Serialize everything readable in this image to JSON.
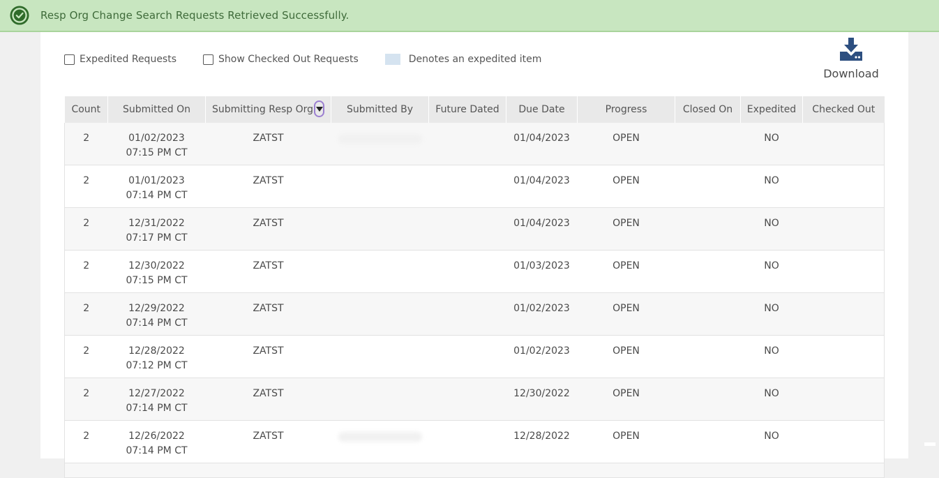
{
  "banner": {
    "message": "Resp Org Change Search Requests Retrieved Successfully.",
    "icon": "check-circle-icon",
    "color": "#c8e6c0"
  },
  "filters": {
    "expedited_label": "Expedited Requests",
    "checked_out_label": "Show Checked Out Requests",
    "legend_label": "Denotes an expedited item",
    "legend_color": "#d5e3f0"
  },
  "download": {
    "label": "Download",
    "icon": "download-icon"
  },
  "table": {
    "headers": [
      "Count",
      "Submitted On",
      "Submitting Resp Org",
      "Submitted By",
      "Future Dated",
      "Due Date",
      "Progress",
      "Closed On",
      "Expedited",
      "Checked Out"
    ],
    "rows": [
      {
        "count": "2",
        "date": "01/02/2023",
        "time": "07:15 PM CT",
        "org": "ZATST",
        "submitted_by": "",
        "future_dated": "",
        "due": "01/04/2023",
        "progress": "OPEN",
        "closed_on": "",
        "expedited": "NO",
        "checked_out": ""
      },
      {
        "count": "2",
        "date": "01/01/2023",
        "time": "07:14 PM CT",
        "org": "ZATST",
        "submitted_by": "",
        "future_dated": "",
        "due": "01/04/2023",
        "progress": "OPEN",
        "closed_on": "",
        "expedited": "NO",
        "checked_out": ""
      },
      {
        "count": "2",
        "date": "12/31/2022",
        "time": "07:17 PM CT",
        "org": "ZATST",
        "submitted_by": "",
        "future_dated": "",
        "due": "01/04/2023",
        "progress": "OPEN",
        "closed_on": "",
        "expedited": "NO",
        "checked_out": ""
      },
      {
        "count": "2",
        "date": "12/30/2022",
        "time": "07:15 PM CT",
        "org": "ZATST",
        "submitted_by": "",
        "future_dated": "",
        "due": "01/03/2023",
        "progress": "OPEN",
        "closed_on": "",
        "expedited": "NO",
        "checked_out": ""
      },
      {
        "count": "2",
        "date": "12/29/2022",
        "time": "07:14 PM CT",
        "org": "ZATST",
        "submitted_by": "",
        "future_dated": "",
        "due": "01/02/2023",
        "progress": "OPEN",
        "closed_on": "",
        "expedited": "NO",
        "checked_out": ""
      },
      {
        "count": "2",
        "date": "12/28/2022",
        "time": "07:12 PM CT",
        "org": "ZATST",
        "submitted_by": "",
        "future_dated": "",
        "due": "01/02/2023",
        "progress": "OPEN",
        "closed_on": "",
        "expedited": "NO",
        "checked_out": ""
      },
      {
        "count": "2",
        "date": "12/27/2022",
        "time": "07:14 PM CT",
        "org": "ZATST",
        "submitted_by": "",
        "future_dated": "",
        "due": "12/30/2022",
        "progress": "OPEN",
        "closed_on": "",
        "expedited": "NO",
        "checked_out": ""
      },
      {
        "count": "2",
        "date": "12/26/2022",
        "time": "07:14 PM CT",
        "org": "ZATST",
        "submitted_by": "",
        "future_dated": "",
        "due": "12/28/2022",
        "progress": "OPEN",
        "closed_on": "",
        "expedited": "NO",
        "checked_out": ""
      }
    ]
  }
}
